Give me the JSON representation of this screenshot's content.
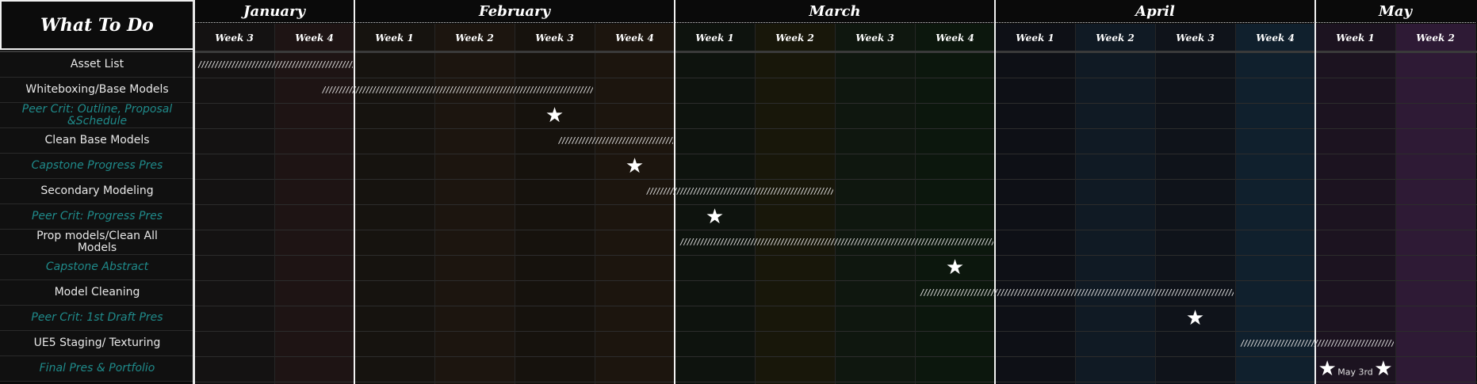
{
  "header": {
    "title": "What To Do"
  },
  "months": [
    {
      "name": "January",
      "weeks": [
        "Week 3",
        "Week 4"
      ]
    },
    {
      "name": "February",
      "weeks": [
        "Week 1",
        "Week 2",
        "Week 3",
        "Week 4"
      ]
    },
    {
      "name": "March",
      "weeks": [
        "Week 1",
        "Week 2",
        "Week 3",
        "Week 4"
      ]
    },
    {
      "name": "April",
      "weeks": [
        "Week 1",
        "Week 2",
        "Week 3",
        "Week 4"
      ]
    },
    {
      "name": "May",
      "weeks": [
        "Week 1",
        "Week 2"
      ]
    }
  ],
  "week_colors": [
    "#141212",
    "#1e1414",
    "#16130f",
    "#1c150f",
    "#16120d",
    "#1c150e",
    "#0e130e",
    "#18170a",
    "#0f170f",
    "#0c170d",
    "#0e1016",
    "#101a24",
    "#0f131a",
    "#10202d",
    "#1c1320",
    "#2e1a35"
  ],
  "tasks": [
    {
      "label": "Asset List",
      "type": "task",
      "bar": {
        "start": 0.0,
        "end": 2.0
      }
    },
    {
      "label": "Whiteboxing/Base Models",
      "type": "task",
      "bar": {
        "start": 1.55,
        "end": 5.0
      }
    },
    {
      "label": "Peer Crit: Outline, Proposal &Schedule",
      "type": "crit",
      "star": 4.5
    },
    {
      "label": "Clean Base Models",
      "type": "task",
      "bar": {
        "start": 4.5,
        "end": 6.0
      }
    },
    {
      "label": "Capstone Progress Pres",
      "type": "crit",
      "star": 5.5
    },
    {
      "label": "Secondary Modeling",
      "type": "task",
      "bar": {
        "start": 5.6,
        "end": 8.0
      }
    },
    {
      "label": "Peer Crit: Progress Pres",
      "type": "crit",
      "star": 6.5
    },
    {
      "label": "Prop models/Clean All Models",
      "type": "task",
      "bar": {
        "start": 6.02,
        "end": 10.0
      }
    },
    {
      "label": "Capstone Abstract",
      "type": "crit",
      "star": 9.5
    },
    {
      "label": "Model Cleaning",
      "type": "task",
      "bar": {
        "start": 9.02,
        "end": 13.0
      }
    },
    {
      "label": "Peer Crit: 1st Draft Pres",
      "type": "crit",
      "star": 12.5
    },
    {
      "label": "UE5 Staging/ Texturing",
      "type": "task",
      "bar": {
        "start": 13.02,
        "end": 15.0
      }
    },
    {
      "label": "Final Pres & Portfolio",
      "type": "crit",
      "star": 14.15,
      "star2": 14.85,
      "note": "May 3rd"
    }
  ]
}
